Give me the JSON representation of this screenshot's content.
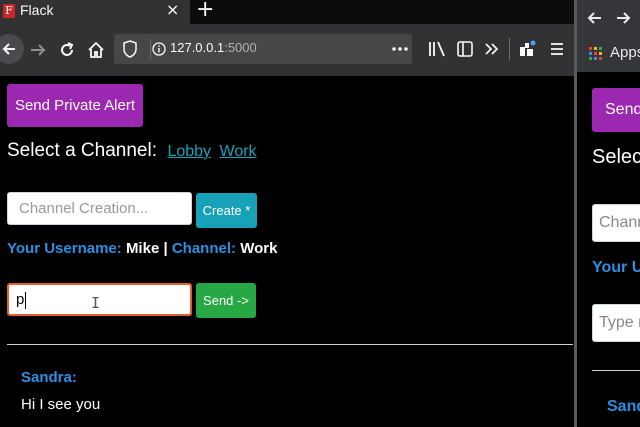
{
  "browser_left": {
    "tab": {
      "title": "Flack",
      "favicon_letter": "F",
      "close": "×"
    },
    "newtab": "+",
    "url": {
      "host": "127.0.0.1",
      "port": ":5000"
    },
    "icons": [
      "back-icon",
      "forward-icon",
      "reload-icon",
      "home-icon",
      "shield-icon",
      "info-icon",
      "page-actions-icon",
      "library-icon",
      "sidebar-icon",
      "overflow-icon",
      "extension-icon",
      "menu-icon"
    ]
  },
  "app": {
    "alert_button": "Send Private Alert",
    "select_label": "Select a Channel:",
    "channels": [
      "Lobby",
      "Work"
    ],
    "create_placeholder": "Channel Creation...",
    "create_button": "Create *",
    "user_label": "Your Username:",
    "username": "Mike",
    "separator": "|",
    "channel_label": "Channel:",
    "current_channel": "Work",
    "message_value": "p",
    "send_button": "Send ->",
    "messages": [
      {
        "user": "Sandra:",
        "text": "Hi I see you"
      }
    ]
  },
  "browser_right": {
    "apps_label": "Apps",
    "alert_button_partial": "Send",
    "select_partial": "Select",
    "create_partial": "Chann",
    "user_partial": "Your U",
    "message_partial": "Type m",
    "msg_user_partial": "Sand"
  },
  "colors": {
    "purple": "#9c27b0",
    "teal": "#17a2b8",
    "green": "#28a745",
    "blue": "#2d8fe0"
  }
}
